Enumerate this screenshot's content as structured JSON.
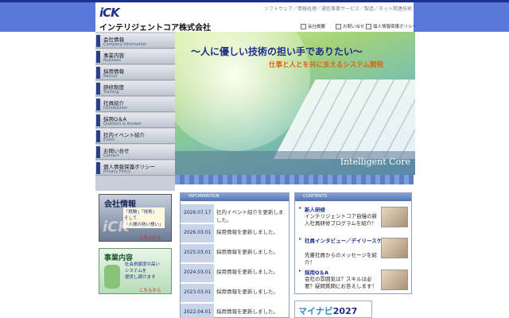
{
  "header": {
    "logo": "iCK",
    "company": "インテリジェントコア株式会社",
    "top_links": "ソフトウェア／情報処理／通信事業サービス／製造／ネット関連技術",
    "util": [
      {
        "label": "会社概要",
        "icon": "building-icon"
      },
      {
        "label": "お問い合せ",
        "icon": "mail-icon"
      },
      {
        "label": "個人情報保護ポリシー",
        "icon": "document-icon"
      }
    ]
  },
  "nav": [
    {
      "jp": "会社情報",
      "en": "Company Information"
    },
    {
      "jp": "事業内容",
      "en": "Business"
    },
    {
      "jp": "採用情報",
      "en": "Recruit"
    },
    {
      "jp": "研修制度",
      "en": "Training"
    },
    {
      "jp": "社員紹介",
      "en": "Introduction"
    },
    {
      "jp": "採用Q＆A",
      "en": "Question & Answer"
    },
    {
      "jp": "社内イベント紹介",
      "en": "Event"
    },
    {
      "jp": "お問い合せ",
      "en": "Contact"
    },
    {
      "jp": "個人情報保護ポリシー",
      "en": "Privacy Policy"
    }
  ],
  "hero": {
    "title": "～人に優しい技術の担い手でありたい～",
    "subtitle": "仕事と人とを共に支えるシステム開発",
    "tagline": "Intelligent Core"
  },
  "banners": {
    "company": {
      "title": "会社情報",
      "quote": "「経験」「技術」",
      "quote2": "そして",
      "quote3": "「人間の熱い想い」",
      "mark": "iCK",
      "link": "こちらから"
    },
    "business": {
      "title": "事業内容",
      "desc1": "社会貢献度の高い",
      "desc2": "システムを",
      "desc3": "提供し続けます",
      "link": "こちらから"
    }
  },
  "information": {
    "header": "INFORMATION",
    "items": [
      {
        "date": "2026.07.17",
        "text": "社内イベント紹介を更新しました。"
      },
      {
        "date": "2026.03.01",
        "text": "採用情報を更新しました。"
      },
      {
        "date": "2025.03.01",
        "text": "採用情報を更新しました。"
      },
      {
        "date": "2024.03.01",
        "text": "採用情報を更新しました。"
      },
      {
        "date": "2023.03.01",
        "text": "採用情報を更新しました。"
      },
      {
        "date": "2022.04.01",
        "text": "採用情報を更新しました。"
      }
    ]
  },
  "contents": {
    "header": "CONTENTS",
    "items": [
      {
        "title": "新人研修",
        "body": "インテリジェントコア自慢の新入社員研修プログラムを紹介！"
      },
      {
        "title": "社員インタビュー／デイリースケジュール",
        "body": "先輩社員からのメッセージを紹介！"
      },
      {
        "title": "採用Q＆A",
        "body": "会社の雰囲気は？スキルは必要？疑問質問にお答えします！"
      }
    ]
  },
  "mynavi": {
    "prefix": "マイナビ",
    "year": "2027"
  }
}
